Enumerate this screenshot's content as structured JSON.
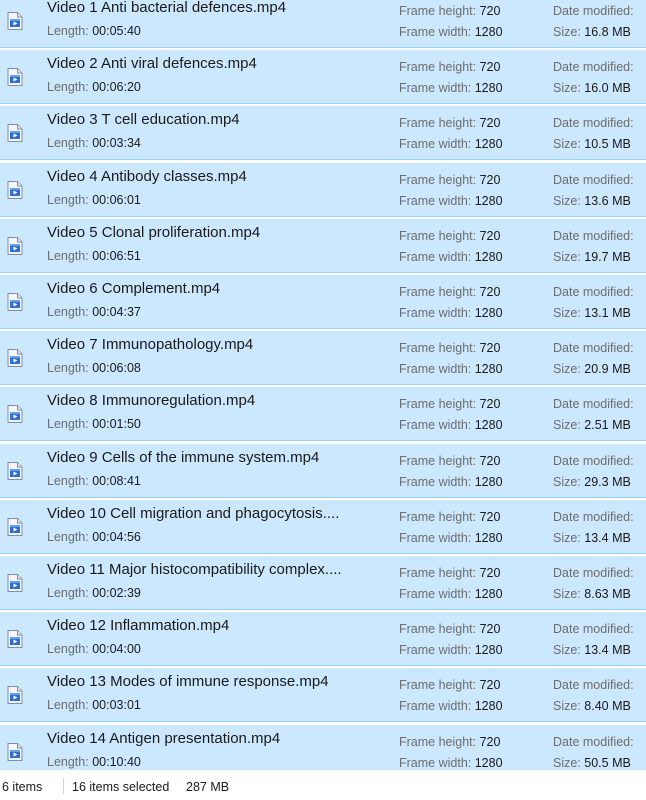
{
  "columns": {
    "length_label": "Length:",
    "frame_height_label": "Frame height:",
    "frame_width_label": "Frame width:",
    "date_modified_label": "Date modified:",
    "size_label": "Size:"
  },
  "files": [
    {
      "name": "Video 1 Anti bacterial defences.mp4",
      "length": "00:05:40",
      "frame_height": "720",
      "frame_width": "1280",
      "size": "16.8 MB",
      "icon": "video-file-icon"
    },
    {
      "name": "Video 2 Anti viral defences.mp4",
      "length": "00:06:20",
      "frame_height": "720",
      "frame_width": "1280",
      "size": "16.0 MB",
      "icon": "video-file-icon"
    },
    {
      "name": "Video 3 T cell education.mp4",
      "length": "00:03:34",
      "frame_height": "720",
      "frame_width": "1280",
      "size": "10.5 MB",
      "icon": "video-file-icon"
    },
    {
      "name": "Video 4 Antibody classes.mp4",
      "length": "00:06:01",
      "frame_height": "720",
      "frame_width": "1280",
      "size": "13.6 MB",
      "icon": "video-file-icon"
    },
    {
      "name": "Video 5 Clonal proliferation.mp4",
      "length": "00:06:51",
      "frame_height": "720",
      "frame_width": "1280",
      "size": "19.7 MB",
      "icon": "video-file-icon"
    },
    {
      "name": "Video 6 Complement.mp4",
      "length": "00:04:37",
      "frame_height": "720",
      "frame_width": "1280",
      "size": "13.1 MB",
      "icon": "video-file-icon"
    },
    {
      "name": "Video 7 Immunopathology.mp4",
      "length": "00:06:08",
      "frame_height": "720",
      "frame_width": "1280",
      "size": "20.9 MB",
      "icon": "video-file-icon"
    },
    {
      "name": "Video 8 Immunoregulation.mp4",
      "length": "00:01:50",
      "frame_height": "720",
      "frame_width": "1280",
      "size": "2.51 MB",
      "icon": "video-file-icon"
    },
    {
      "name": "Video 9 Cells of the immune system.mp4",
      "length": "00:08:41",
      "frame_height": "720",
      "frame_width": "1280",
      "size": "29.3 MB",
      "icon": "video-file-icon"
    },
    {
      "name": "Video 10 Cell migration and phagocytosis....",
      "length": "00:04:56",
      "frame_height": "720",
      "frame_width": "1280",
      "size": "13.4 MB",
      "icon": "video-file-icon"
    },
    {
      "name": "Video 11 Major histocompatibility complex....",
      "length": "00:02:39",
      "frame_height": "720",
      "frame_width": "1280",
      "size": "8.63 MB",
      "icon": "video-file-icon"
    },
    {
      "name": "Video 12 Inflammation.mp4",
      "length": "00:04:00",
      "frame_height": "720",
      "frame_width": "1280",
      "size": "13.4 MB",
      "icon": "video-file-icon"
    },
    {
      "name": "Video 13 Modes of immune response.mp4",
      "length": "00:03:01",
      "frame_height": "720",
      "frame_width": "1280",
      "size": "8.40 MB",
      "icon": "video-file-icon"
    },
    {
      "name": "Video 14 Antigen presentation.mp4",
      "length": "00:10:40",
      "frame_height": "720",
      "frame_width": "1280",
      "size": "50.5 MB",
      "icon": "video-file-icon"
    }
  ],
  "status_bar": {
    "item_count": "6 items",
    "selection": "16 items selected",
    "selection_size": "287 MB"
  },
  "colors": {
    "selection_bg": "#cce8ff",
    "selection_border": "#99d1ff",
    "secondary_text": "#6d6d6d"
  }
}
